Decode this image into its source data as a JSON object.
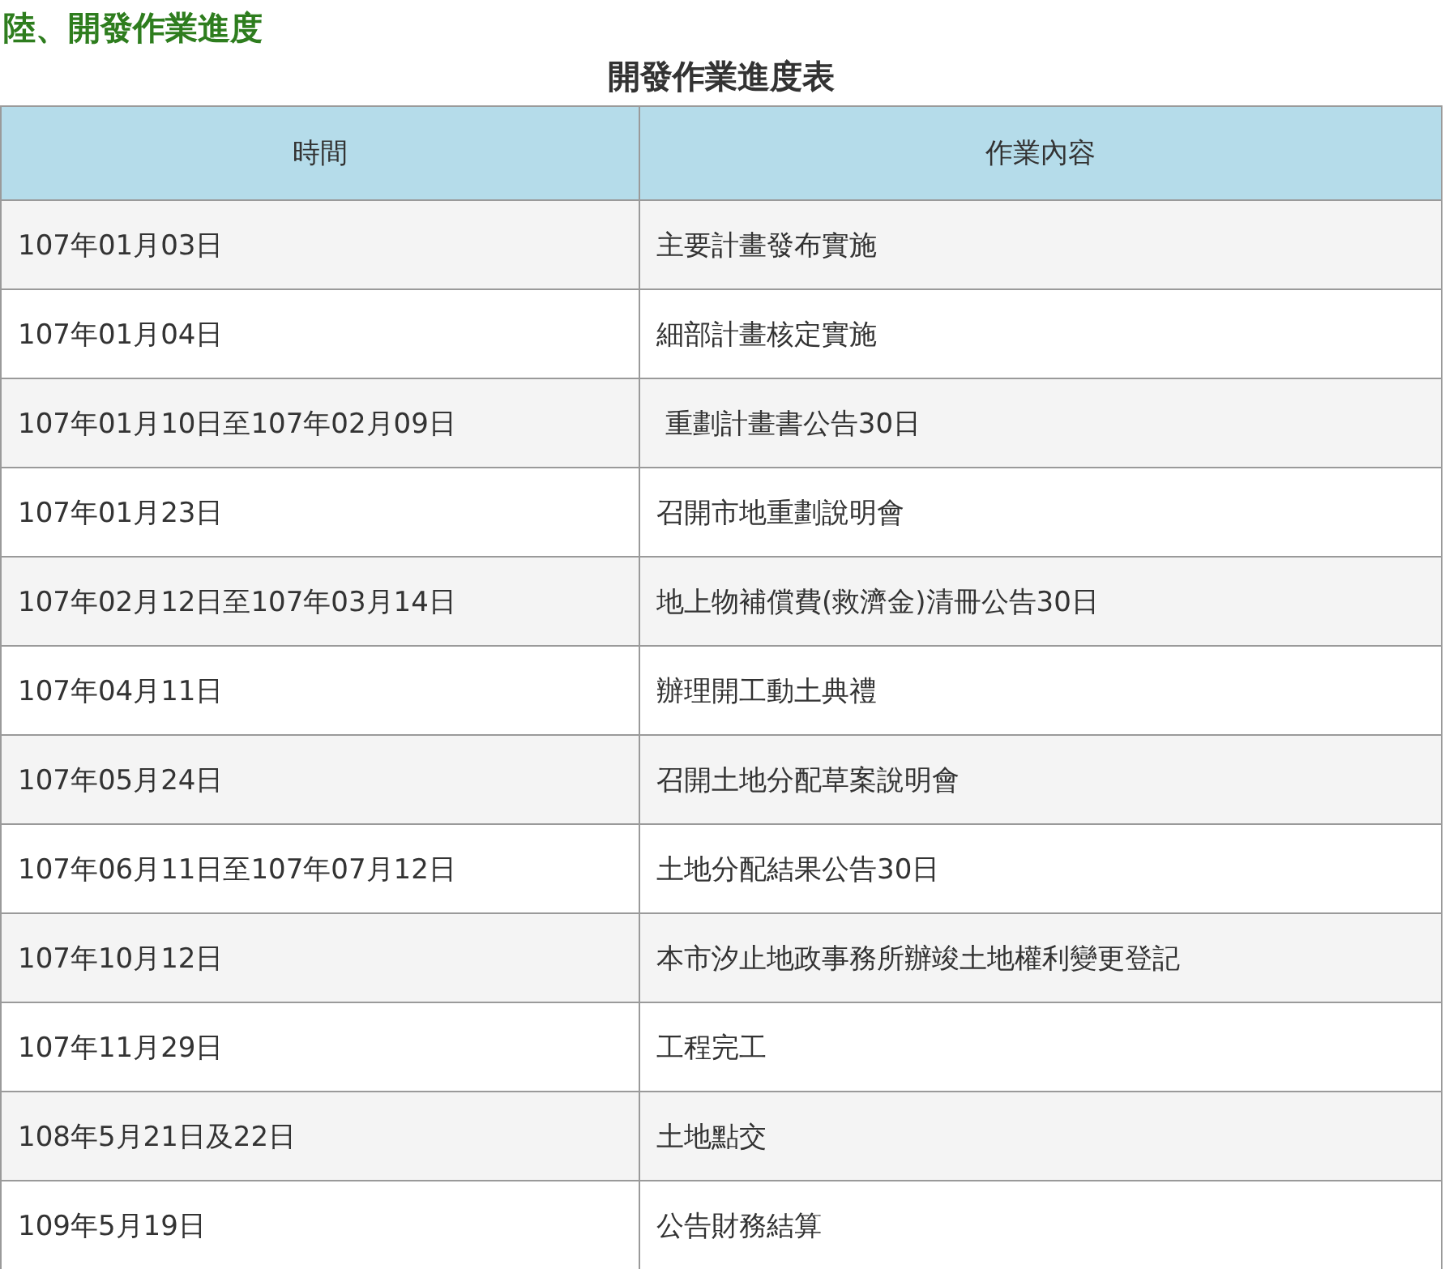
{
  "heading": "陸、開發作業進度",
  "table": {
    "caption": "開發作業進度表",
    "columns": [
      "時間",
      "作業內容"
    ],
    "rows": [
      [
        "107年01月03日",
        "主要計畫發布實施"
      ],
      [
        "107年01月04日",
        "細部計畫核定實施"
      ],
      [
        "107年01月10日至107年02月09日",
        " 重劃計畫書公告30日"
      ],
      [
        "107年01月23日",
        "召開市地重劃說明會"
      ],
      [
        "107年02月12日至107年03月14日",
        "地上物補償費(救濟金)清冊公告30日"
      ],
      [
        "107年04月11日",
        "辦理開工動土典禮"
      ],
      [
        "107年05月24日",
        "召開土地分配草案說明會"
      ],
      [
        "107年06月11日至107年07月12日",
        "土地分配結果公告30日"
      ],
      [
        "107年10月12日",
        "本市汐止地政事務所辦竣土地權利變更登記"
      ],
      [
        "107年11月29日",
        "工程完工"
      ],
      [
        "108年5月21日及22日",
        "土地點交"
      ],
      [
        "109年5月19日",
        "公告財務結算"
      ]
    ]
  }
}
